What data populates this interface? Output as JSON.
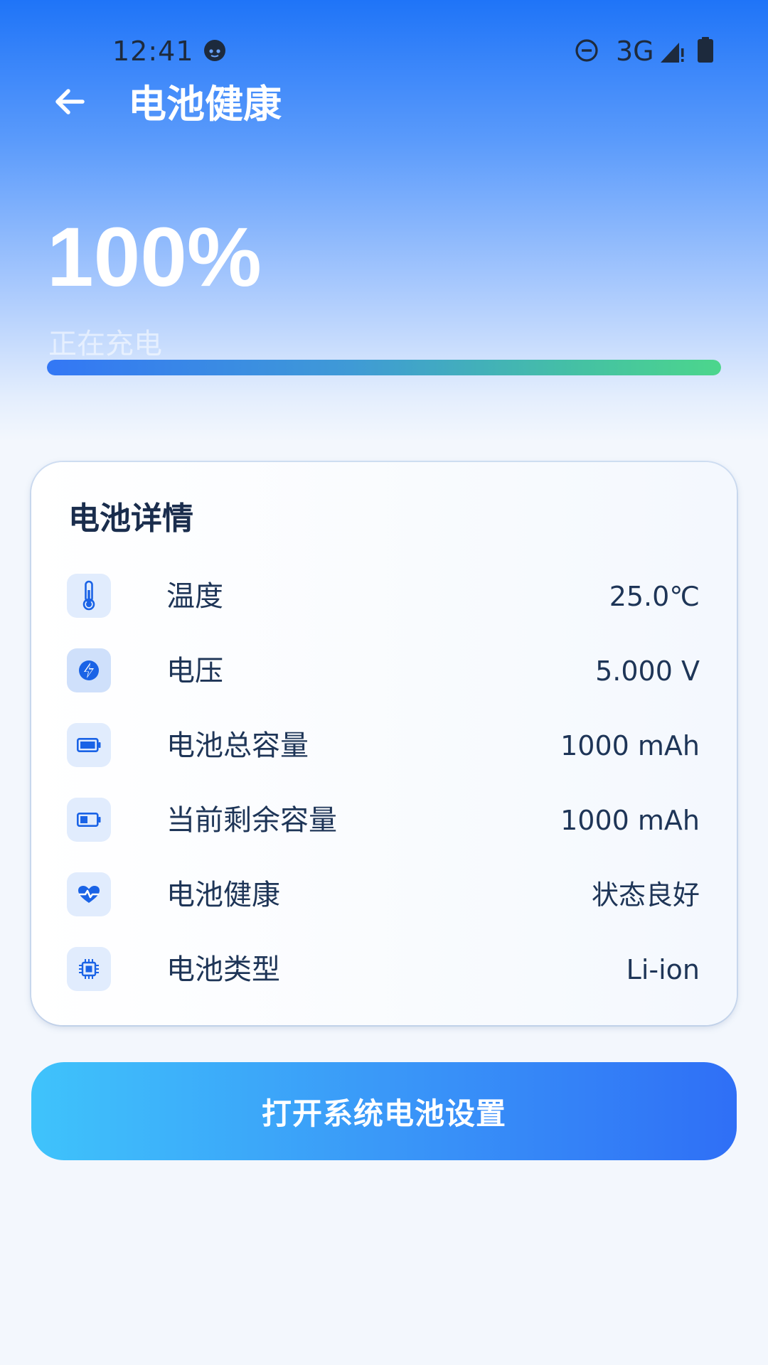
{
  "status_bar": {
    "time": "12:41",
    "network": "3G",
    "face_icon": "face-icon",
    "dnd_icon": "do-not-disturb-icon",
    "signal_icon": "cell-signal-icon",
    "battery_icon": "battery-full-icon"
  },
  "app_bar": {
    "back_icon": "arrow-left-icon",
    "title": "电池健康"
  },
  "battery": {
    "percent_text": "100%",
    "level_fraction": 1.0,
    "status": "正在充电"
  },
  "details": {
    "title": "电池详情",
    "items": [
      {
        "label": "温度",
        "value": "25.0℃",
        "icon": "thermometer-icon"
      },
      {
        "label": "电压",
        "value": "5.000 V",
        "icon": "bolt-icon"
      },
      {
        "label": "电池总容量",
        "value": "1000 mAh",
        "icon": "battery-full-icon"
      },
      {
        "label": "当前剩余容量",
        "value": "1000 mAh",
        "icon": "battery-half-icon"
      },
      {
        "label": "电池健康",
        "value": "状态良好",
        "icon": "health-heart-icon"
      },
      {
        "label": "电池类型",
        "value": "Li-ion",
        "icon": "chip-icon"
      }
    ]
  },
  "action": {
    "label": "打开系统电池设置"
  },
  "colors": {
    "accent": "#1f74f8",
    "icon_blue": "#1a63e6",
    "progress_start": "#3377f5",
    "progress_end": "#4cd68c",
    "button_start": "#3fc3fb",
    "button_end": "#2f6ff6"
  }
}
